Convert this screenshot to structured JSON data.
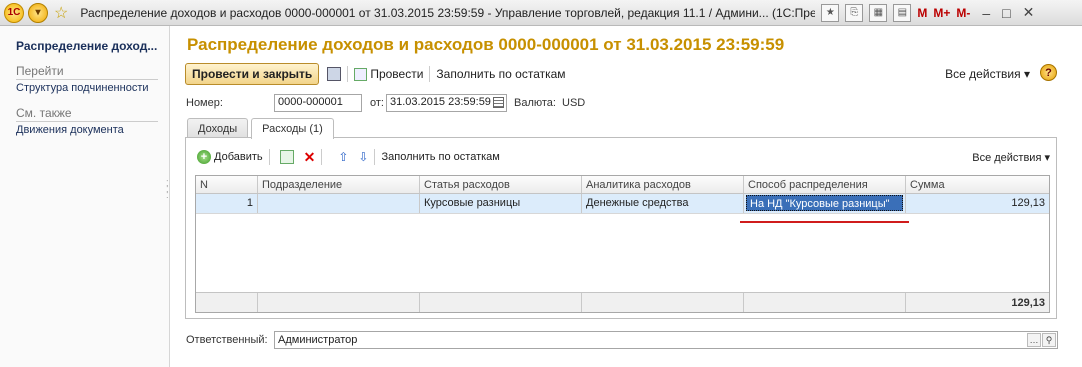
{
  "window": {
    "title": "Распределение доходов и расходов  0000-000001 от 31.03.2015 23:59:59 - Управление торговлей, редакция 11.1 / Админи...  (1С:Предприятие)",
    "logo_text": "1С",
    "menu_glyph": "▾",
    "star_glyph": "☆",
    "m_labels": [
      "M",
      "M+",
      "M-"
    ],
    "controls": [
      "–",
      "□",
      "✕"
    ]
  },
  "sidebar": {
    "active": "Распределение доход...",
    "go_section": "Перейти",
    "go_items": [
      "Структура подчиненности"
    ],
    "see_also_section": "См. также",
    "see_also_items": [
      "Движения документа"
    ]
  },
  "doc": {
    "title": "Распределение доходов и расходов  0000-000001 от 31.03.2015 23:59:59"
  },
  "toolbar": {
    "post_close": "Провести и закрыть",
    "post": "Провести",
    "fill": "Заполнить по остаткам",
    "all_actions": "Все действия",
    "help": "?"
  },
  "header": {
    "number_label": "Номер:",
    "number": "0000-000001",
    "date_label": "от:",
    "date": "31.03.2015 23:59:59",
    "currency_label": "Валюта:",
    "currency": "USD"
  },
  "tabs": [
    {
      "label": "Доходы",
      "active": false
    },
    {
      "label": "Расходы (1)",
      "active": true
    }
  ],
  "table_toolbar": {
    "add": "Добавить",
    "fill": "Заполнить по остаткам",
    "all_actions": "Все действия"
  },
  "table": {
    "columns": [
      "N",
      "Подразделение",
      "Статья расходов",
      "Аналитика расходов",
      "Способ распределения",
      "Сумма"
    ],
    "rows": [
      {
        "n": "1",
        "division": "",
        "expense_item": "Курсовые разницы",
        "analytics": "Денежные средства",
        "method": "На НД \"Курсовые разницы\"",
        "amount": "129,13"
      }
    ],
    "total": "129,13"
  },
  "footer": {
    "responsible_label": "Ответственный:",
    "responsible": "Администратор"
  },
  "colors": {
    "title": "#c79000",
    "highlight": "#3a6fb8",
    "underline": "#d01c1c"
  }
}
